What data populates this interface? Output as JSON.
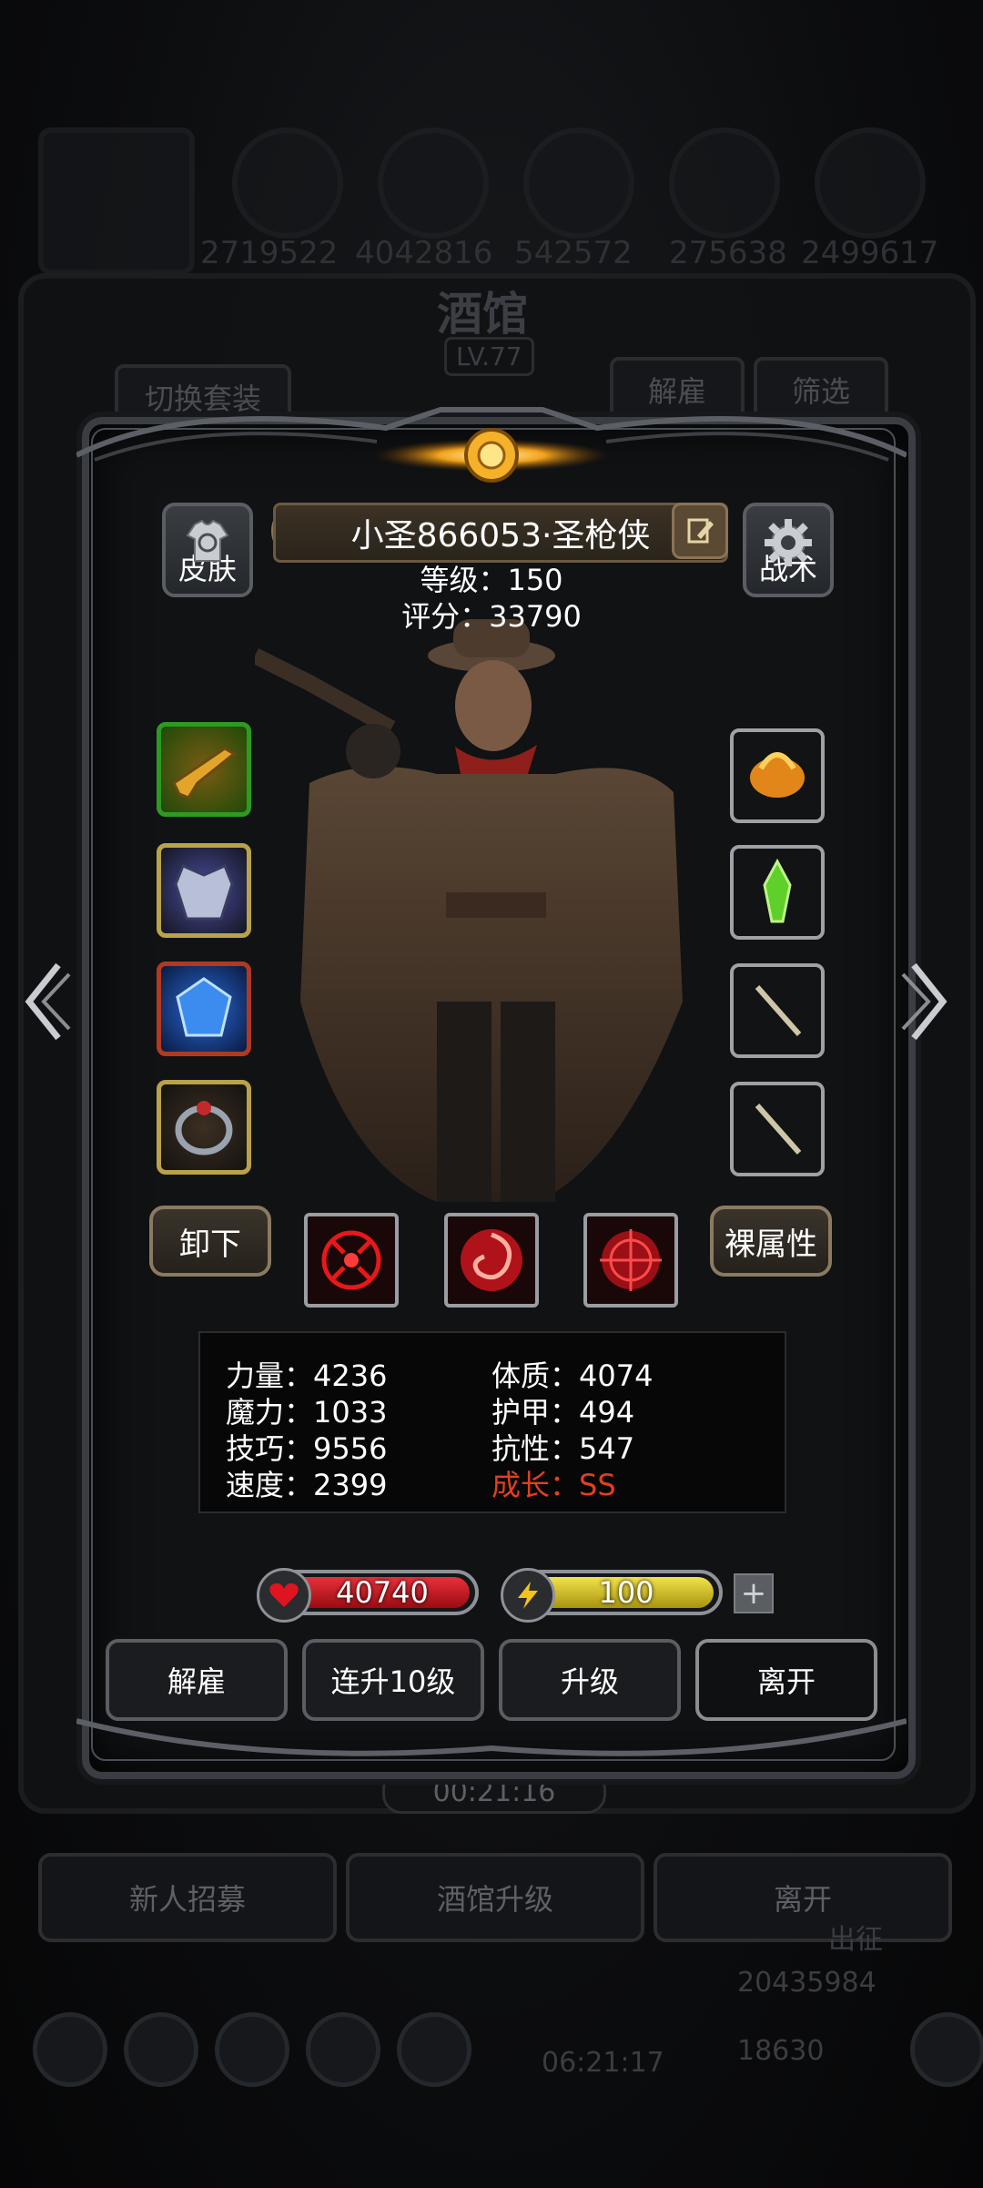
{
  "background": {
    "numbers_row": [
      "2719522",
      "4042816",
      "542572",
      "275638",
      "2499617"
    ],
    "shop_title": "酒馆",
    "shop_level": "LV.77",
    "switch_set_label": "切换套装",
    "dismiss_label": "解雇",
    "filter_label": "筛选",
    "timer": "00:21:16",
    "recruit_label": "新人招募",
    "upgrade_tavern_label": "酒馆升级",
    "leave_label": "离开",
    "gold": "20435984",
    "gems": "18630",
    "bottom_timer": "06:21:17",
    "expedition_label": "出征"
  },
  "hero": {
    "skin_label": "皮肤",
    "tactics_label": "战术",
    "name": "小圣866053·圣枪侠",
    "level_text": "等级：150",
    "score_text": "评分：33790"
  },
  "actions": {
    "unequip_label": "卸下",
    "base_attr_label": "裸属性"
  },
  "stats": {
    "strength": "力量：4236",
    "constitution": "体质：4074",
    "magic": "魔力：1033",
    "armor": "护甲：494",
    "skill": "技巧：9556",
    "resistance": "抗性：547",
    "speed": "速度：2399",
    "growth": "成长：SS"
  },
  "bars": {
    "hp": "40740",
    "energy": "100"
  },
  "buttons": {
    "dismiss": "解雇",
    "level_up_10": "连升10级",
    "upgrade": "升级",
    "leave": "离开"
  },
  "colors": {
    "hp_fill": "#c8141c",
    "energy_fill": "#d9c21a",
    "growth": "#e0401f"
  }
}
